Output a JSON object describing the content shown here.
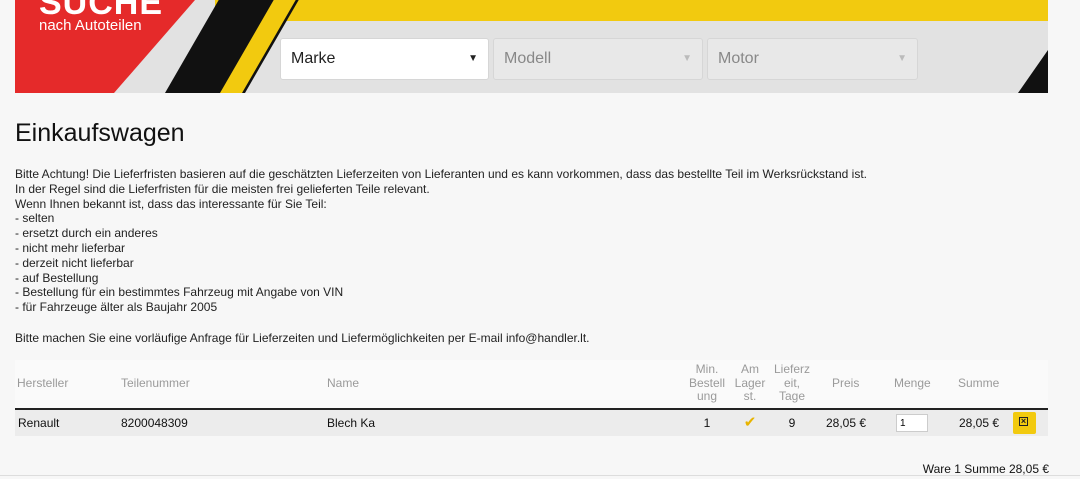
{
  "logo": {
    "title": "SUCHE",
    "subtitle": "nach Autoteilen"
  },
  "search": {
    "brand": "Marke",
    "model": "Modell",
    "engine": "Motor"
  },
  "page_title": "Einkaufswagen",
  "notice_lines": [
    "Bitte Achtung! Die Lieferfristen basieren auf die geschätzten Lieferzeiten von Lieferanten und es kann vorkommen, dass das bestellte Teil im Werksrückstand ist.",
    "In der Regel sind die Lieferfristen für die meisten frei gelieferten Teile relevant.",
    "Wenn Ihnen bekannt ist, dass das interessante für Sie Teil:",
    "- selten",
    "- ersetzt durch ein anderes",
    "- nicht mehr lieferbar",
    "- derzeit nicht lieferbar",
    "- auf Bestellung",
    "- Bestellung für ein bestimmtes Fahrzeug mit Angabe von VIN",
    "- für Fahrzeuge älter als Baujahr 2005"
  ],
  "contact": "Bitte machen Sie eine vorläufige Anfrage für Lieferzeiten und Liefermöglichkeiten per E-mail info@handler.lt.",
  "table": {
    "headers": {
      "manufacturer": "Hersteller",
      "part_number": "Teilenummer",
      "name": "Name",
      "min_order": [
        "Min.",
        "Bestell",
        "ung"
      ],
      "in_stock": [
        "Am",
        "Lager",
        "st."
      ],
      "delivery": [
        "Lieferz",
        "eit,",
        "Tage"
      ],
      "price": "Preis",
      "quantity": "Menge",
      "sum": "Summe"
    },
    "rows": [
      {
        "manufacturer": "Renault",
        "part_number": "8200048309",
        "name": "Blech Ka",
        "min_order": "1",
        "in_stock_icon": "check-icon",
        "delivery_days": "9",
        "price": "28,05 €",
        "quantity": "1",
        "sum": "28,05 €"
      }
    ]
  },
  "total": "Ware 1 Summe 28,05 €"
}
